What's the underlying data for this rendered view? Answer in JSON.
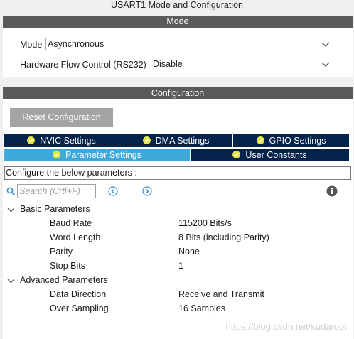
{
  "window": {
    "title": "USART1 Mode and Configuration"
  },
  "mode_section": {
    "header": "Mode",
    "mode_label": "Mode",
    "mode_value": "Asynchronous",
    "flow_label": "Hardware Flow Control (RS232)",
    "flow_value": "Disable"
  },
  "config_section": {
    "header": "Configuration",
    "reset_button": "Reset Configuration",
    "tabs_top": [
      {
        "label": "NVIC Settings",
        "icon": "check-circle-icon"
      },
      {
        "label": "DMA Settings",
        "icon": "check-circle-icon"
      },
      {
        "label": "GPIO Settings",
        "icon": "check-circle-icon"
      }
    ],
    "tabs_bottom": [
      {
        "label": "Parameter Settings",
        "icon": "check-circle-icon",
        "active": true
      },
      {
        "label": "User Constants",
        "icon": "check-circle-icon",
        "active": false
      }
    ],
    "configure_text": "Configure the below parameters :",
    "search_placeholder": "Search (Crtl+F)"
  },
  "parameters": {
    "basic": {
      "label": "Basic Parameters",
      "items": [
        {
          "name": "Baud Rate",
          "value": "115200 Bits/s"
        },
        {
          "name": "Word Length",
          "value": "8 Bits (including Parity)"
        },
        {
          "name": "Parity",
          "value": "None"
        },
        {
          "name": "Stop Bits",
          "value": "1"
        }
      ]
    },
    "advanced": {
      "label": "Advanced Parameters",
      "items": [
        {
          "name": "Data Direction",
          "value": "Receive and Transmit"
        },
        {
          "name": "Over Sampling",
          "value": "16 Samples"
        }
      ]
    }
  },
  "watermark": "https://blog.csdn.net/sudaroot",
  "colors": {
    "header_bar": "#5a5a5a",
    "tab_dark": "#03234b",
    "tab_active": "#3fa9dc",
    "check": "#e5e542"
  }
}
